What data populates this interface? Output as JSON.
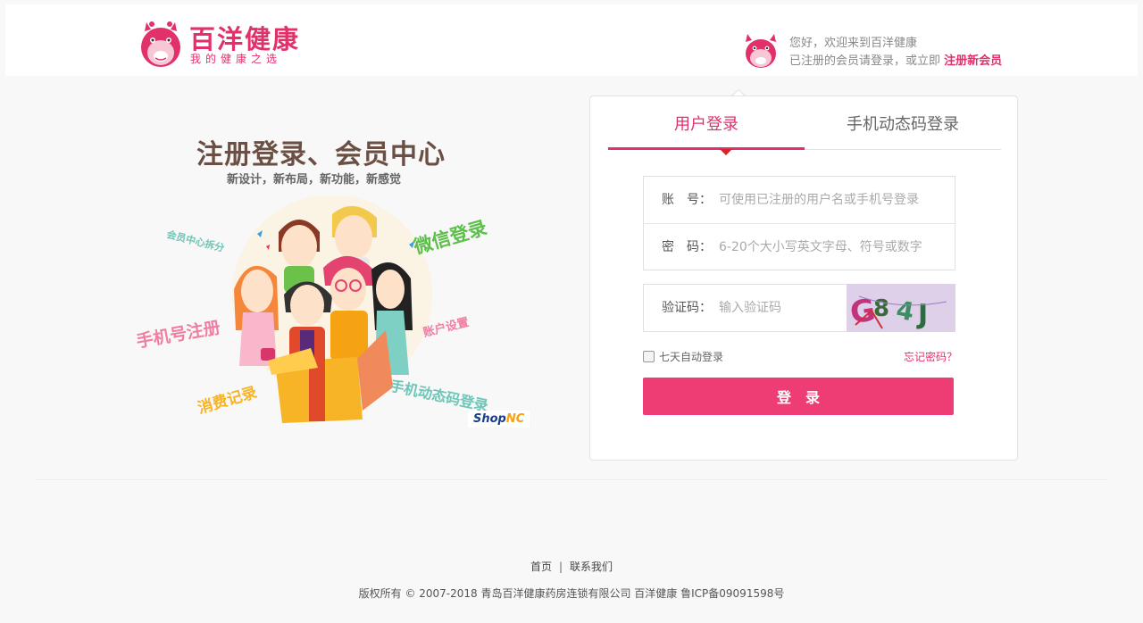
{
  "header": {
    "logo_title": "百洋健康",
    "logo_slogan": "我的健康之选",
    "welcome_line1": "您好，欢迎来到百洋健康",
    "welcome_line2_prefix": "已注册的会员请登录，或立即",
    "register_link": "注册新会员",
    "brand_color": "#e2316a"
  },
  "promo": {
    "title": "注册登录、会员中心",
    "subtitle": "新设计，新布局，新功能，新感觉",
    "tags": {
      "member_split": "会员中心拆分",
      "wechat_login": "微信登录",
      "phone_register": "手机号注册",
      "account_settings": "账户设置",
      "consume_record": "消费记录",
      "sms_login": "手机动态码登录"
    },
    "watermark_a": "Shop",
    "watermark_b": "NC"
  },
  "login": {
    "tab_active": "用户登录",
    "tab_other": "手机动态码登录",
    "account_label": "账　号：",
    "account_placeholder": "可使用已注册的用户名或手机号登录",
    "password_label": "密　码：",
    "password_placeholder": "6-20个大小写英文字母、符号或数字",
    "captcha_label": "验证码：",
    "captcha_placeholder": "输入验证码",
    "captcha_text": "G84J",
    "remember_label": "七天自动登录",
    "forgot_link": "忘记密码？",
    "submit_label": "登录",
    "button_color": "#ee3d74"
  },
  "footer": {
    "home_link": "首页",
    "separator": "|",
    "contact_link": "联系我们",
    "copyright": "版权所有 © 2007-2018 青岛百洋健康药房连锁有限公司 百洋健康 鲁ICP备09091598号"
  }
}
